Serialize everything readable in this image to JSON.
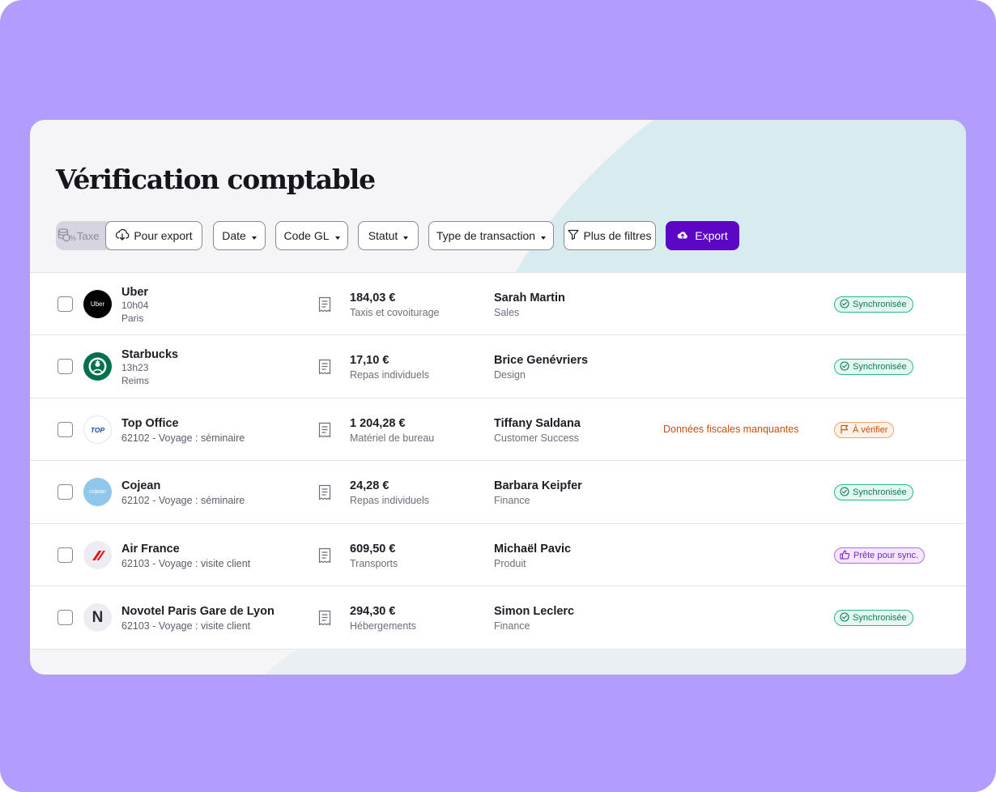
{
  "page": {
    "title": "Vérification comptable"
  },
  "toolbar": {
    "taxe_label": "Taxe",
    "taxe_pct": "%",
    "pour_export": "Pour export",
    "date": "Date",
    "code_gl": "Code GL",
    "statut": "Statut",
    "type_transaction": "Type de transaction",
    "plus_filtres": "Plus de filtres",
    "export": "Export"
  },
  "colors": {
    "background": "#b29cfe",
    "accent": "#5c07c6",
    "sync": "#0d7a57",
    "warning": "#c4500f",
    "ready": "#7a22c4"
  },
  "rows": [
    {
      "merchant": "Uber",
      "line1": "10h04",
      "line2": "Paris",
      "logo": "uber-logo",
      "logo_text": "Uber",
      "amount": "184,03 €",
      "category": "Taxis et covoiturage",
      "person": "Sarah Martin",
      "team": "Sales",
      "warning": "",
      "status": "Synchronisée",
      "status_type": "sync"
    },
    {
      "merchant": "Starbucks",
      "line1": "13h23",
      "line2": "Reims",
      "logo": "starbucks-logo",
      "logo_text": "",
      "amount": "17,10 €",
      "category": "Repas individuels",
      "person": "Brice Genévriers",
      "team": "Design",
      "warning": "",
      "status": "Synchronisée",
      "status_type": "sync"
    },
    {
      "merchant": "Top Office",
      "line1": "62102 - Voyage : séminaire",
      "line2": "",
      "logo": "top-office-logo",
      "logo_text": "TOP",
      "amount": "1 204,28 €",
      "category": "Matériel de bureau",
      "person": "Tiffany Saldana",
      "team": "Customer Success",
      "warning": "Données fiscales manquantes",
      "status": "À vérifier",
      "status_type": "verif"
    },
    {
      "merchant": "Cojean",
      "line1": "62102 - Voyage : séminaire",
      "line2": "",
      "logo": "cojean-logo",
      "logo_text": "cojean",
      "amount": "24,28 €",
      "category": "Repas individuels",
      "person": "Barbara Keipfer",
      "team": "Finance",
      "warning": "",
      "status": "Synchronisée",
      "status_type": "sync"
    },
    {
      "merchant": "Air France",
      "line1": "62103 - Voyage : visite client",
      "line2": "",
      "logo": "air-france-logo",
      "logo_text": "",
      "amount": "609,50 €",
      "category": "Transports",
      "person": "Michaël Pavic",
      "team": "Produit",
      "warning": "",
      "status": "Prête pour sync.",
      "status_type": "ready"
    },
    {
      "merchant": "Novotel Paris Gare de Lyon",
      "line1": "62103 - Voyage : visite client",
      "line2": "",
      "logo": "novotel-logo",
      "logo_text": "N",
      "amount": "294,30 €",
      "category": "Hébergements",
      "person": "Simon Leclerc",
      "team": "Finance",
      "warning": "",
      "status": "Synchronisée",
      "status_type": "sync"
    }
  ]
}
